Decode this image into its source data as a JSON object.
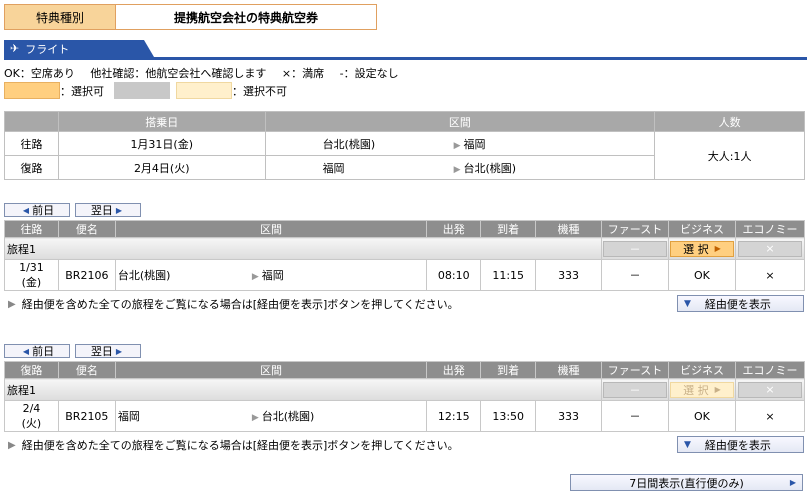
{
  "award": {
    "label": "特典種別",
    "value": "提携航空会社の特典航空券"
  },
  "section_tab": "フライト",
  "legend": {
    "ok": "OK：空席あり",
    "other": "他社確認：他航空会社へ確認します",
    "full": "×：満席",
    "none": "-：設定なし",
    "selectable": "：選択可",
    "not_selectable": "：選択不可"
  },
  "summary": {
    "headers": [
      "",
      "搭乗日",
      "区間",
      "人数"
    ],
    "rows": [
      {
        "dir": "往路",
        "date": "1月31日(金)",
        "from": "台北(桃園)",
        "to": "福岡"
      },
      {
        "dir": "復路",
        "date": "2月4日(火)",
        "from": "福岡",
        "to": "台北(桃園)"
      }
    ],
    "pax": "大人:1人"
  },
  "nav": {
    "prev": "前日",
    "next": "翌日"
  },
  "columns": [
    "便名",
    "区間",
    "出発",
    "到着",
    "機種",
    "ファースト",
    "ビジネス",
    "エコノミー"
  ],
  "seat_labels": {
    "dash": "－",
    "select": "選 択",
    "cross": "×"
  },
  "outbound": {
    "dir": "往路",
    "journey": "旅程1",
    "flight": {
      "date": "1/31\n(金)",
      "date1": "1/31",
      "date2": "(金)",
      "no": "BR2106",
      "from": "台北(桃園)",
      "to": "福岡",
      "dep": "08:10",
      "arr": "11:15",
      "aircraft": "333",
      "first": "－",
      "business": "OK",
      "economy": "×"
    }
  },
  "return": {
    "dir": "復路",
    "journey": "旅程1",
    "flight": {
      "date1": "2/4",
      "date2": "(火)",
      "no": "BR2105",
      "from": "福岡",
      "to": "台北(桃園)",
      "dep": "12:15",
      "arr": "13:50",
      "aircraft": "333",
      "first": "－",
      "business": "OK",
      "economy": "×"
    }
  },
  "note": "経由便を含めた全ての旅程をご覧になる場合は[経由便を表示]ボタンを押してください。",
  "via_button": "経由便を表示",
  "week_button": "7日間表示(直行便のみ)",
  "colors": {
    "accent": "#2a56a8",
    "selectable": "#ffcf80",
    "header_gray": "#8e8e8e"
  }
}
